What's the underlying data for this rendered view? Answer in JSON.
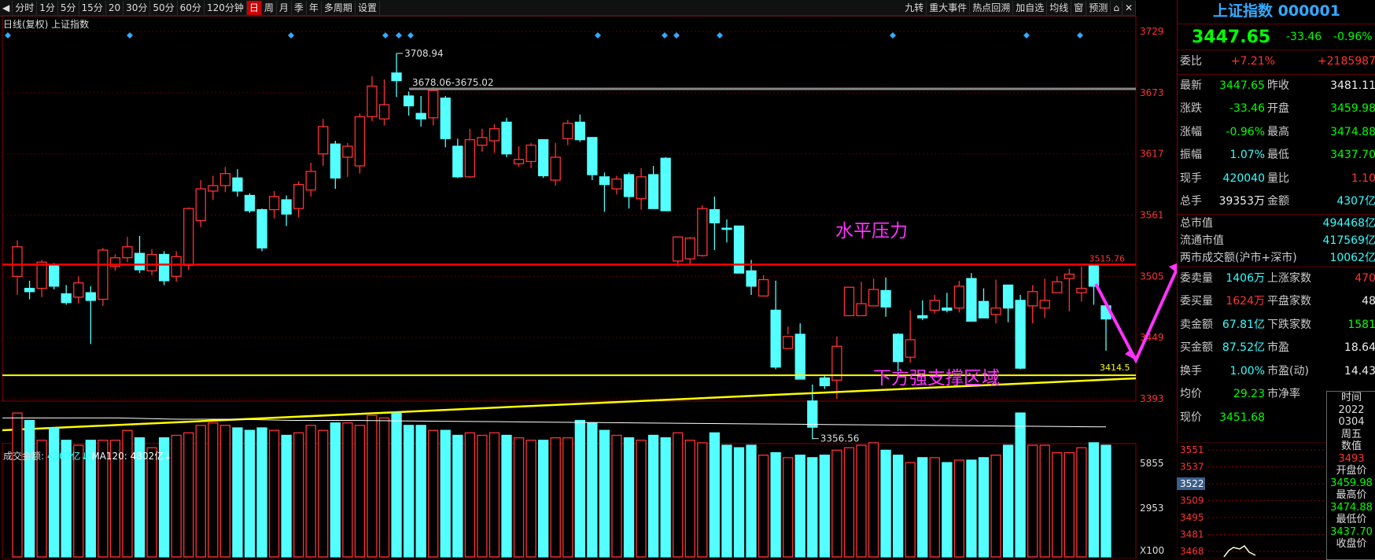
{
  "toolbar": {
    "left": [
      "分时",
      "1分",
      "5分",
      "15分",
      "20",
      "30分",
      "50分",
      "60分",
      "120分钟",
      "日",
      "周",
      "月",
      "季",
      "年",
      "多周期",
      "设置"
    ],
    "active_index": 9,
    "right": [
      "九转",
      "重大事件",
      "热点回溯",
      "加自选",
      "均线",
      "窗",
      "预测"
    ]
  },
  "chart_title": "日线(复权) 上证指数",
  "price_axis": {
    "labels": [
      "3729",
      "3673",
      "3617",
      "3561",
      "3505",
      "3449",
      "3393"
    ],
    "values": [
      3729,
      3673,
      3617,
      3561,
      3505,
      3449,
      3393
    ],
    "red_line_label": "3515.76",
    "yellow_line_label": "3414.5"
  },
  "annotations": {
    "high": "3708.94",
    "range": "3678.06-3675.02",
    "low": "3356.56",
    "resistance": "水平压力",
    "support": "下方强支撑区域"
  },
  "volume": {
    "title_label": "成交金额:",
    "title_value": "4307亿",
    "ma_label": "MA120:",
    "ma_value": "4802亿",
    "axis_labels": [
      "5855",
      "2953",
      "X100"
    ]
  },
  "colors": {
    "up": "#ff3232",
    "down": "#54ffff",
    "resistance": "#ff0000",
    "support": "#ffff00",
    "arrow": "#ff33ff",
    "text_anno": "#ff33ff"
  },
  "candles": [
    [
      3505,
      3532,
      3488,
      3538
    ],
    [
      3494,
      3491,
      3484,
      3501
    ],
    [
      3494,
      3518,
      3486,
      3520
    ],
    [
      3515,
      3496,
      3493,
      3517
    ],
    [
      3489,
      3481,
      3479,
      3497
    ],
    [
      3486,
      3499,
      3480,
      3505
    ],
    [
      3490,
      3483,
      3443,
      3496
    ],
    [
      3484,
      3529,
      3478,
      3531
    ],
    [
      3514,
      3522,
      3510,
      3525
    ],
    [
      3522,
      3532,
      3518,
      3541
    ],
    [
      3526,
      3511,
      3508,
      3542
    ],
    [
      3510,
      3525,
      3506,
      3530
    ],
    [
      3525,
      3501,
      3497,
      3528
    ],
    [
      3505,
      3523,
      3500,
      3528
    ],
    [
      3515,
      3567,
      3511,
      3568
    ],
    [
      3556,
      3585,
      3550,
      3593
    ],
    [
      3583,
      3588,
      3575,
      3597
    ],
    [
      3588,
      3599,
      3582,
      3605
    ],
    [
      3595,
      3583,
      3578,
      3603
    ],
    [
      3579,
      3565,
      3563,
      3581
    ],
    [
      3566,
      3531,
      3528,
      3567
    ],
    [
      3566,
      3578,
      3558,
      3583
    ],
    [
      3575,
      3562,
      3551,
      3579
    ],
    [
      3567,
      3589,
      3559,
      3592
    ],
    [
      3584,
      3601,
      3578,
      3609
    ],
    [
      3617,
      3642,
      3606,
      3649
    ],
    [
      3626,
      3595,
      3585,
      3629
    ],
    [
      3614,
      3624,
      3596,
      3627
    ],
    [
      3606,
      3651,
      3599,
      3654
    ],
    [
      3651,
      3679,
      3647,
      3688
    ],
    [
      3649,
      3662,
      3643,
      3685
    ],
    [
      3691,
      3684,
      3669,
      3709
    ],
    [
      3670,
      3661,
      3652,
      3674
    ],
    [
      3654,
      3649,
      3642,
      3670
    ],
    [
      3650,
      3675,
      3643,
      3678
    ],
    [
      3668,
      3631,
      3623,
      3670
    ],
    [
      3624,
      3596,
      3595,
      3631
    ],
    [
      3596,
      3630,
      3595,
      3640
    ],
    [
      3625,
      3632,
      3619,
      3640
    ],
    [
      3629,
      3640,
      3618,
      3644
    ],
    [
      3646,
      3617,
      3614,
      3650
    ],
    [
      3608,
      3612,
      3605,
      3624
    ],
    [
      3610,
      3625,
      3604,
      3627
    ],
    [
      3630,
      3597,
      3595,
      3630
    ],
    [
      3593,
      3614,
      3588,
      3627
    ],
    [
      3631,
      3645,
      3625,
      3648
    ],
    [
      3646,
      3630,
      3628,
      3653
    ],
    [
      3632,
      3598,
      3593,
      3632
    ],
    [
      3596,
      3589,
      3564,
      3600
    ],
    [
      3585,
      3594,
      3580,
      3597
    ],
    [
      3598,
      3578,
      3567,
      3600
    ],
    [
      3576,
      3596,
      3566,
      3604
    ],
    [
      3598,
      3567,
      3568,
      3606
    ],
    [
      3613,
      3565,
      3565,
      3614
    ],
    [
      3519,
      3541,
      3514,
      3541
    ],
    [
      3521,
      3540,
      3516,
      3541
    ],
    [
      3524,
      3567,
      3523,
      3570
    ],
    [
      3566,
      3554,
      3529,
      3578
    ],
    [
      3549,
      3548,
      3536,
      3557
    ],
    [
      3551,
      3508,
      3515,
      3539
    ],
    [
      3510,
      3496,
      3488,
      3520
    ],
    [
      3487,
      3502,
      3493,
      3506
    ],
    [
      3474,
      3422,
      3420,
      3501
    ],
    [
      3439,
      3450,
      3452,
      3459
    ],
    [
      3452,
      3411,
      3413,
      3462
    ],
    [
      3391,
      3367,
      3356,
      3406
    ],
    [
      3412,
      3405,
      3402,
      3414
    ],
    [
      3410,
      3441,
      3393,
      3450
    ],
    [
      3469,
      3495,
      3474,
      3477
    ],
    [
      3469,
      3480,
      3472,
      3500
    ],
    [
      3478,
      3493,
      3491,
      3503
    ],
    [
      3492,
      3477,
      3468,
      3504
    ],
    [
      3452,
      3427,
      3418,
      3453
    ],
    [
      3431,
      3447,
      3426,
      3474
    ],
    [
      3469,
      3467,
      3465,
      3483
    ],
    [
      3474,
      3483,
      3471,
      3488
    ],
    [
      3476,
      3474,
      3472,
      3490
    ],
    [
      3476,
      3496,
      3472,
      3501
    ],
    [
      3503,
      3464,
      3467,
      3508
    ],
    [
      3482,
      3467,
      3471,
      3494
    ],
    [
      3470,
      3476,
      3462,
      3502
    ],
    [
      3497,
      3476,
      3463,
      3494
    ],
    [
      3483,
      3421,
      3420,
      3488
    ],
    [
      3478,
      3491,
      3462,
      3497
    ],
    [
      3476,
      3483,
      3467,
      3503
    ],
    [
      3490,
      3500,
      3493,
      3505
    ],
    [
      3503,
      3507,
      3473,
      3512
    ],
    [
      3490,
      3494,
      3482,
      3514
    ],
    [
      3515,
      3496,
      3479,
      3516
    ],
    [
      3478,
      3466,
      3437,
      3482
    ]
  ],
  "volumes": [
    58,
    55,
    47,
    52,
    47,
    45,
    47,
    47,
    47,
    51,
    48,
    44,
    48,
    49,
    50,
    53,
    54,
    53,
    52,
    51,
    52,
    51,
    49,
    50,
    53,
    51,
    54,
    54,
    53,
    57,
    56,
    58,
    53,
    53,
    51,
    51,
    49,
    50,
    49,
    50,
    49,
    48,
    47,
    47,
    48,
    48,
    55,
    54,
    51,
    49,
    48,
    47,
    49,
    48,
    50,
    47,
    46,
    50,
    45,
    44,
    45,
    41,
    42,
    40,
    41,
    40,
    41,
    43,
    44,
    45,
    46,
    43,
    41,
    38,
    40,
    40,
    38,
    39,
    39,
    40,
    41,
    45,
    58,
    45,
    45,
    42,
    42,
    44,
    46,
    45
  ],
  "ma_line": [
    56,
    56,
    56,
    55.5,
    55.5,
    55,
    55,
    54.8,
    54.6,
    54.4,
    54.2,
    54,
    53.8,
    53.6,
    53.4,
    53.2,
    53,
    52.8,
    52.6,
    52.4
  ],
  "sidebar": {
    "title": "上证指数 000001",
    "price": "3447.65",
    "change": "-33.46",
    "pct": "-0.96%",
    "weibi": {
      "label": "委比",
      "v1": "+7.21%",
      "v2": "+2185987"
    },
    "rows": [
      {
        "l1": "最新",
        "v1": "3447.65",
        "c1": "g",
        "l2": "昨收",
        "v2": "3481.11",
        "c2": "w"
      },
      {
        "l1": "涨跌",
        "v1": "-33.46",
        "c1": "g",
        "l2": "开盘",
        "v2": "3459.98",
        "c2": "g"
      },
      {
        "l1": "涨幅",
        "v1": "-0.96%",
        "c1": "g",
        "l2": "最高",
        "v2": "3474.88",
        "c2": "g"
      },
      {
        "l1": "振幅",
        "v1": "1.07%",
        "c1": "c",
        "l2": "最低",
        "v2": "3437.70",
        "c2": "g"
      },
      {
        "l1": "现手",
        "v1": "420040",
        "c1": "c",
        "l2": "量比",
        "v2": "1.10",
        "c2": "r"
      },
      {
        "l1": "总手",
        "v1": "39353万",
        "c1": "w",
        "l2": "金额",
        "v2": "4307亿",
        "c2": "c"
      }
    ],
    "caps": [
      {
        "l": "总市值",
        "v": "494468亿"
      },
      {
        "l": "流通市值",
        "v": "417569亿"
      },
      {
        "l": "两市成交额(沪市+深市)",
        "v": "10062亿"
      }
    ],
    "rows2": [
      {
        "l1": "委卖量",
        "v1": "1406万",
        "c1": "c",
        "l2": "上涨家数",
        "v2": "470",
        "c2": "r"
      },
      {
        "l1": "委买量",
        "v1": "1624万",
        "c1": "r",
        "l2": "平盘家数",
        "v2": "48",
        "c2": "w"
      },
      {
        "l1": "卖金额",
        "v1": "67.81亿",
        "c1": "c",
        "l2": "下跌家数",
        "v2": "1581",
        "c2": "g"
      },
      {
        "l1": "买金额",
        "v1": "87.52亿",
        "c1": "c",
        "l2": "市盈",
        "v2": "18.64",
        "c2": "w"
      },
      {
        "l1": "换手",
        "v1": "1.00%",
        "c1": "c",
        "l2": "市盈(动)",
        "v2": "14.43",
        "c2": "w"
      },
      {
        "l1": "均价",
        "v1": "29.23",
        "c1": "g",
        "l2": "市净率",
        "v2": "",
        "c2": "w"
      },
      {
        "l1": "现价",
        "v1": "3451.68",
        "c1": "g",
        "l2": "",
        "v2": "2022",
        "c2": "w"
      }
    ],
    "mini_axis": [
      "3551",
      "3537",
      "3522",
      "3509",
      "3495",
      "3481",
      "3468"
    ]
  },
  "tooltip": [
    "时间",
    "2022",
    "0304",
    "周五",
    "数值",
    "3493",
    "开盘价",
    "3459.98",
    "最高价",
    "3474.88",
    "最低价",
    "3437.70",
    "收盘价"
  ]
}
